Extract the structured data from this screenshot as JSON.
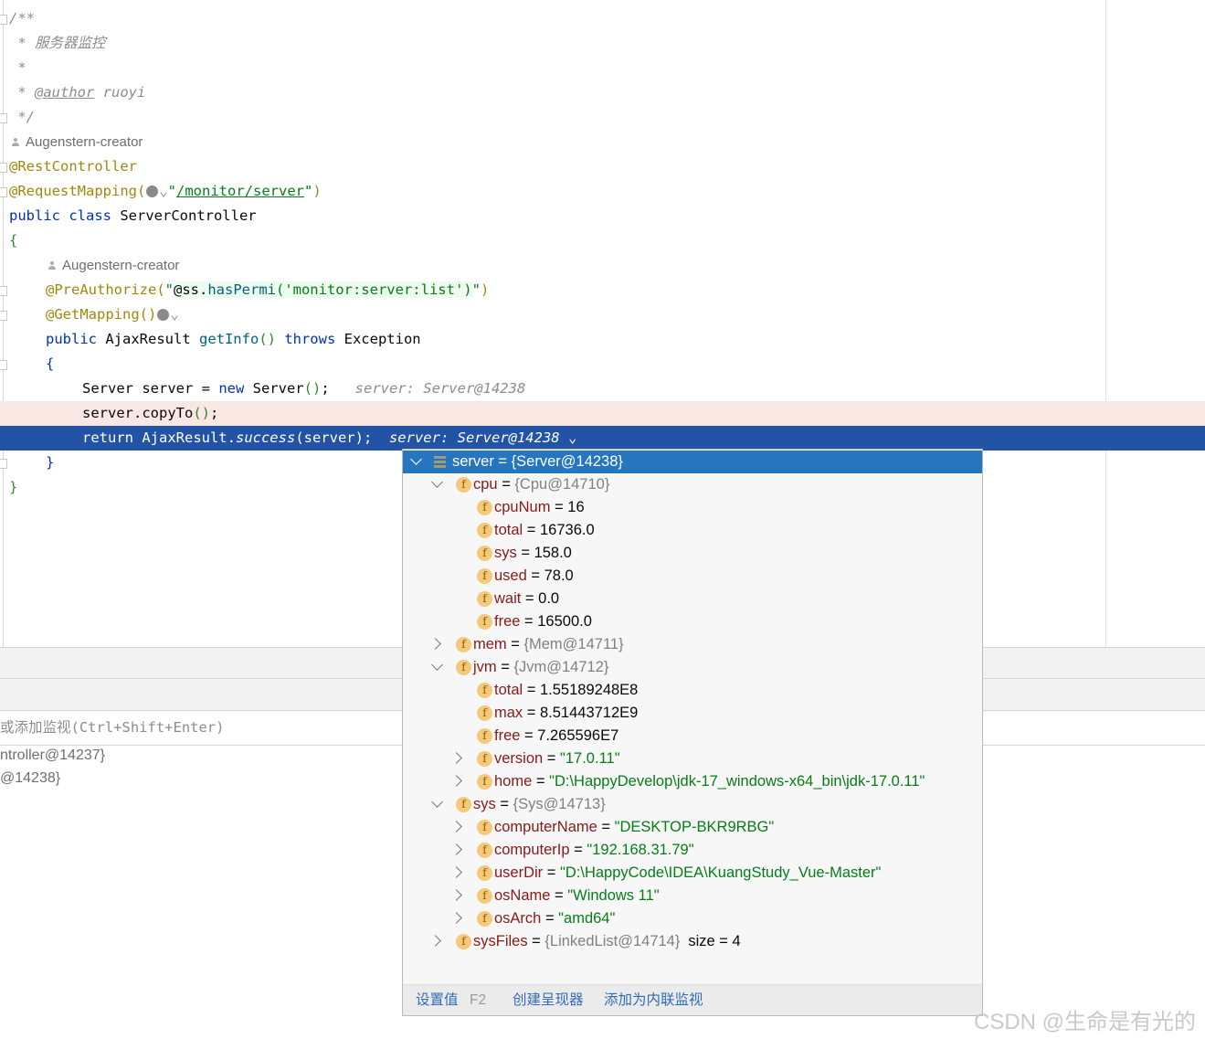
{
  "editor": {
    "author_hints": [
      "Augenstern-creator",
      "Augenstern-creator"
    ],
    "lines": [
      {
        "indent": 0,
        "hl": "",
        "tokens": [
          [
            "/**",
            "comment"
          ]
        ]
      },
      {
        "indent": 0,
        "hl": "",
        "tokens": [
          [
            " * 服务器监控",
            "comment"
          ]
        ]
      },
      {
        "indent": 0,
        "hl": "",
        "tokens": [
          [
            " *",
            "comment"
          ]
        ]
      },
      {
        "indent": 0,
        "hl": "",
        "tokens": [
          [
            " * ",
            "comment"
          ],
          [
            "@author",
            "doctag"
          ],
          [
            " ruoyi",
            "comment"
          ]
        ]
      },
      {
        "indent": 0,
        "hl": "",
        "tokens": [
          [
            " */",
            "comment"
          ]
        ]
      },
      {
        "author": 0
      },
      {
        "indent": 0,
        "hl": "",
        "tokens": [
          [
            "@RestController",
            "anno"
          ]
        ]
      },
      {
        "indent": 0,
        "hl": "",
        "tokens": [
          [
            "@RequestMapping(",
            "anno"
          ],
          [
            "globe",
            ""
          ],
          [
            "\"",
            "str"
          ],
          [
            "/monitor/server",
            "link"
          ],
          [
            "\"",
            "str"
          ],
          [
            ")",
            "anno"
          ]
        ]
      },
      {
        "indent": 0,
        "hl": "",
        "tokens": [
          [
            "public class ",
            "kw"
          ],
          [
            "ServerController",
            "plain"
          ]
        ]
      },
      {
        "indent": 0,
        "hl": "",
        "tokens": [
          [
            "{",
            "paren"
          ]
        ]
      },
      {
        "author": 1
      },
      {
        "indent": 1,
        "hl": "",
        "tokens": [
          [
            "@PreAuthorize(",
            "anno"
          ],
          [
            "\"",
            "str"
          ],
          [
            "@ss.",
            "plain spel"
          ],
          [
            "hasPermi",
            "method spel"
          ],
          [
            "('monitor:server:list')",
            "str spel"
          ],
          [
            "\"",
            "str"
          ],
          [
            ")",
            "anno"
          ]
        ]
      },
      {
        "indent": 1,
        "hl": "",
        "tokens": [
          [
            "@GetMapping()",
            "anno"
          ],
          [
            "globe",
            ""
          ]
        ]
      },
      {
        "indent": 1,
        "hl": "",
        "tokens": [
          [
            "public ",
            "kw"
          ],
          [
            "AjaxResult ",
            "plain"
          ],
          [
            "getInfo",
            "method"
          ],
          [
            "()",
            "paren"
          ],
          [
            " throws ",
            "kw"
          ],
          [
            "Exception",
            "plain"
          ]
        ]
      },
      {
        "indent": 1,
        "hl": "",
        "tokens": [
          [
            "{",
            "kw"
          ]
        ]
      },
      {
        "indent": 2,
        "hl": "",
        "tokens": [
          [
            "Server server = ",
            "plain"
          ],
          [
            "new ",
            "kw"
          ],
          [
            "Server",
            "plain"
          ],
          [
            "()",
            "paren"
          ],
          [
            ";",
            "plain"
          ],
          [
            "   server: Server@14238",
            "inlay"
          ]
        ]
      },
      {
        "indent": 2,
        "hl": "pink",
        "tokens": [
          [
            "server.copyTo",
            "plain"
          ],
          [
            "()",
            "paren"
          ],
          [
            ";",
            "plain"
          ]
        ]
      },
      {
        "indent": 2,
        "hl": "blue",
        "tokens": [
          [
            "return AjaxResult.",
            "plain"
          ],
          [
            "success",
            "italic"
          ],
          [
            "(server);",
            "plain"
          ],
          [
            "  server: Server@14238",
            "inlay"
          ],
          [
            " ⌄",
            "inlay"
          ]
        ]
      },
      {
        "indent": 1,
        "hl": "",
        "tokens": [
          [
            "}",
            "kw"
          ]
        ]
      },
      {
        "indent": 0,
        "hl": "",
        "tokens": [
          [
            "}",
            "paren"
          ]
        ]
      }
    ]
  },
  "debug_panel": {
    "watch_placeholder": "或添加监视(Ctrl+Shift+Enter)",
    "variables": [
      "ntroller@14237}",
      "@14238}"
    ]
  },
  "popup": {
    "rows": [
      {
        "level": 0,
        "state": "expanded",
        "icon": "stack",
        "name": "server",
        "value": "{Server@14238}",
        "type": "ref",
        "selected": true
      },
      {
        "level": 1,
        "state": "expanded",
        "icon": "field",
        "name": "cpu",
        "value": "{Cpu@14710}",
        "type": "ref"
      },
      {
        "level": 2,
        "state": "leaf",
        "icon": "field",
        "name": "cpuNum",
        "value": "16",
        "type": "num"
      },
      {
        "level": 2,
        "state": "leaf",
        "icon": "field",
        "name": "total",
        "value": "16736.0",
        "type": "num"
      },
      {
        "level": 2,
        "state": "leaf",
        "icon": "field",
        "name": "sys",
        "value": "158.0",
        "type": "num"
      },
      {
        "level": 2,
        "state": "leaf",
        "icon": "field",
        "name": "used",
        "value": "78.0",
        "type": "num"
      },
      {
        "level": 2,
        "state": "leaf",
        "icon": "field",
        "name": "wait",
        "value": "0.0",
        "type": "num"
      },
      {
        "level": 2,
        "state": "leaf",
        "icon": "field",
        "name": "free",
        "value": "16500.0",
        "type": "num"
      },
      {
        "level": 1,
        "state": "collapsed",
        "icon": "field",
        "name": "mem",
        "value": "{Mem@14711}",
        "type": "ref"
      },
      {
        "level": 1,
        "state": "expanded",
        "icon": "field",
        "name": "jvm",
        "value": "{Jvm@14712}",
        "type": "ref"
      },
      {
        "level": 2,
        "state": "leaf",
        "icon": "field",
        "name": "total",
        "value": "1.55189248E8",
        "type": "num"
      },
      {
        "level": 2,
        "state": "leaf",
        "icon": "field",
        "name": "max",
        "value": "8.51443712E9",
        "type": "num"
      },
      {
        "level": 2,
        "state": "leaf",
        "icon": "field",
        "name": "free",
        "value": "7.265596E7",
        "type": "num"
      },
      {
        "level": 2,
        "state": "collapsed",
        "icon": "field",
        "name": "version",
        "value": "\"17.0.11\"",
        "type": "str"
      },
      {
        "level": 2,
        "state": "collapsed",
        "icon": "field",
        "name": "home",
        "value": "\"D:\\HappyDevelop\\jdk-17_windows-x64_bin\\jdk-17.0.11\"",
        "type": "str"
      },
      {
        "level": 1,
        "state": "expanded",
        "icon": "field",
        "name": "sys",
        "value": "{Sys@14713}",
        "type": "ref"
      },
      {
        "level": 2,
        "state": "collapsed",
        "icon": "field",
        "name": "computerName",
        "value": "\"DESKTOP-BKR9RBG\"",
        "type": "str"
      },
      {
        "level": 2,
        "state": "collapsed",
        "icon": "field",
        "name": "computerIp",
        "value": "\"192.168.31.79\"",
        "type": "str"
      },
      {
        "level": 2,
        "state": "collapsed",
        "icon": "field",
        "name": "userDir",
        "value": "\"D:\\HappyCode\\IDEA\\KuangStudy_Vue-Master\"",
        "type": "str"
      },
      {
        "level": 2,
        "state": "collapsed",
        "icon": "field",
        "name": "osName",
        "value": "\"Windows 11\"",
        "type": "str"
      },
      {
        "level": 2,
        "state": "collapsed",
        "icon": "field",
        "name": "osArch",
        "value": "\"amd64\"",
        "type": "str"
      },
      {
        "level": 1,
        "state": "collapsed",
        "icon": "field",
        "name": "sysFiles",
        "value": "{LinkedList@14714}",
        "type": "ref",
        "extra": "size = 4"
      }
    ],
    "footer": {
      "set_value": "设置值",
      "set_value_key": "F2",
      "create_renderer": "创建呈现器",
      "add_inline_watch": "添加为内联监视"
    }
  },
  "watermark": "CSDN @生命是有光的"
}
